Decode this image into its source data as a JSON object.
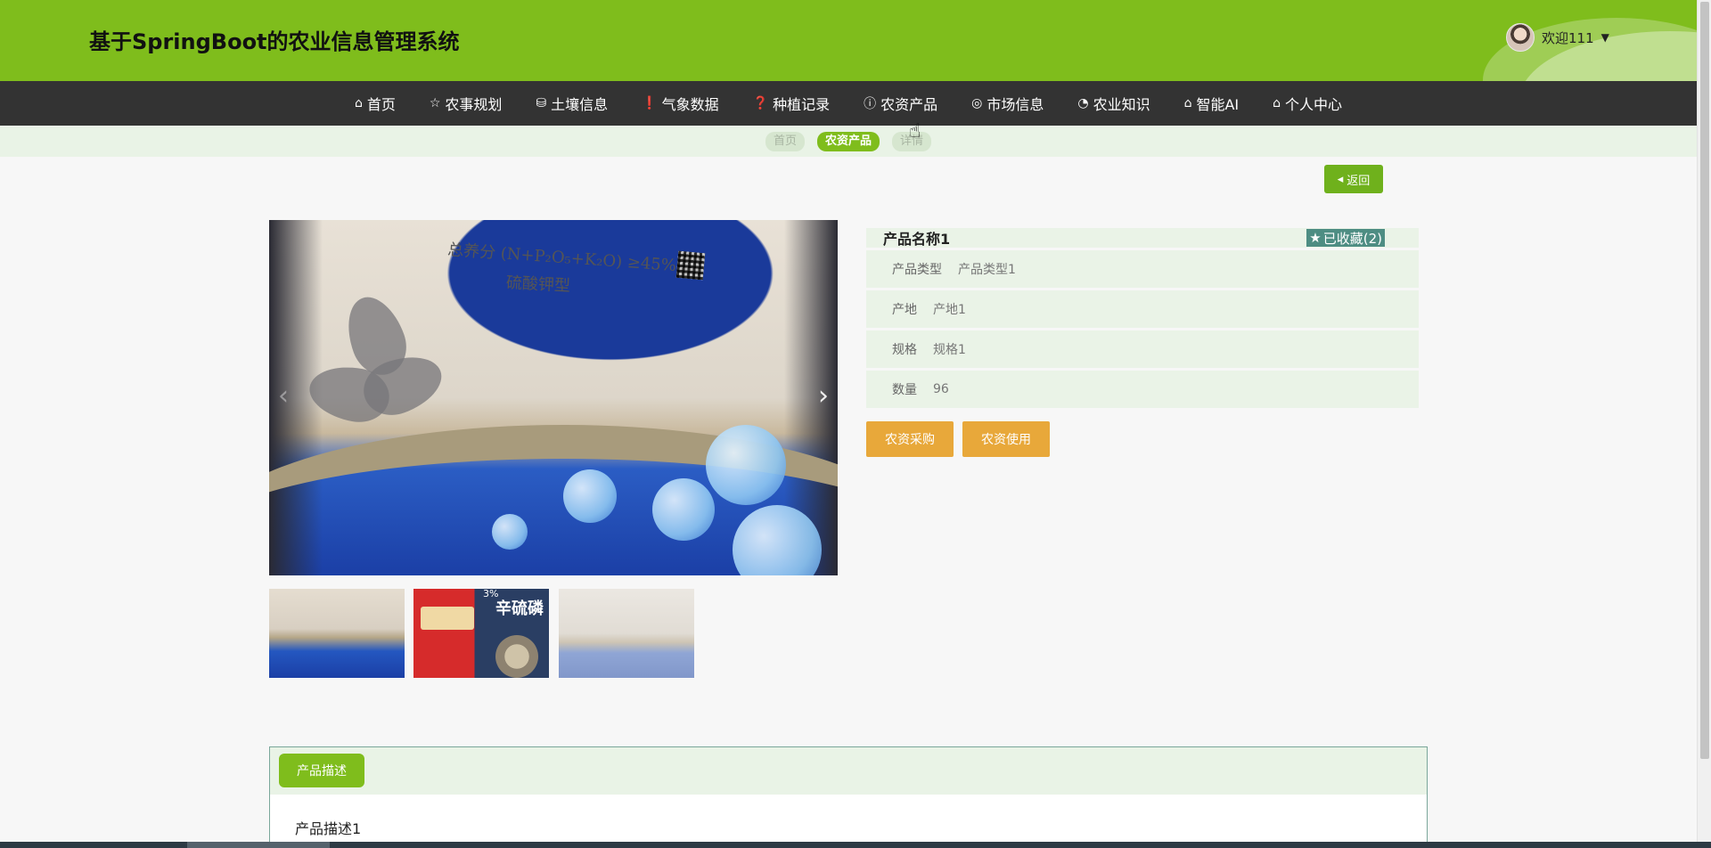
{
  "header": {
    "title": "基于SpringBoot的农业信息管理系统",
    "user": {
      "name": "欢迎111",
      "caret": "▼"
    }
  },
  "nav": {
    "items": [
      {
        "label": "首页",
        "icon": "home-icon",
        "glyph": "⌂"
      },
      {
        "label": "农事规划",
        "icon": "star-icon",
        "glyph": "☆"
      },
      {
        "label": "土壤信息",
        "icon": "bag-icon",
        "glyph": "⛁"
      },
      {
        "label": "气象数据",
        "icon": "alert-icon",
        "glyph": "❗"
      },
      {
        "label": "种植记录",
        "icon": "question-icon",
        "glyph": "❓"
      },
      {
        "label": "农资产品",
        "icon": "info-icon",
        "glyph": "ⓘ"
      },
      {
        "label": "市场信息",
        "icon": "globe-icon",
        "glyph": "◎"
      },
      {
        "label": "农业知识",
        "icon": "dashboard-icon",
        "glyph": "◔"
      },
      {
        "label": "智能AI",
        "icon": "home-icon",
        "glyph": "⌂"
      },
      {
        "label": "个人中心",
        "icon": "home-icon",
        "glyph": "⌂"
      }
    ]
  },
  "breadcrumb": {
    "items": [
      "首页",
      "农资产品",
      "详情"
    ]
  },
  "back_button": {
    "label": "返回",
    "icon": "caret-left-icon"
  },
  "gallery": {
    "main_text_line1": "总养分 (N+P₂O₅+K₂O) ≥45%",
    "main_text_line2": "硫酸钾型",
    "thumb2_title": "辛硫磷",
    "thumb2_top": "3%"
  },
  "product": {
    "name": "产品名称1",
    "favorite_label": "已收藏(2)",
    "fields": [
      {
        "label": "产品类型",
        "value": "产品类型1"
      },
      {
        "label": "产地",
        "value": "产地1"
      },
      {
        "label": "规格",
        "value": "规格1"
      },
      {
        "label": "数量",
        "value": "96"
      }
    ]
  },
  "actions": {
    "purchase": "农资采购",
    "use": "农资使用"
  },
  "description": {
    "tab": "产品描述",
    "content": "产品描述1"
  },
  "colors": {
    "header_green": "#7fbd1c",
    "nav_dark": "#333333",
    "action_orange": "#e8a83a",
    "favorite_teal": "#4e8d83"
  }
}
